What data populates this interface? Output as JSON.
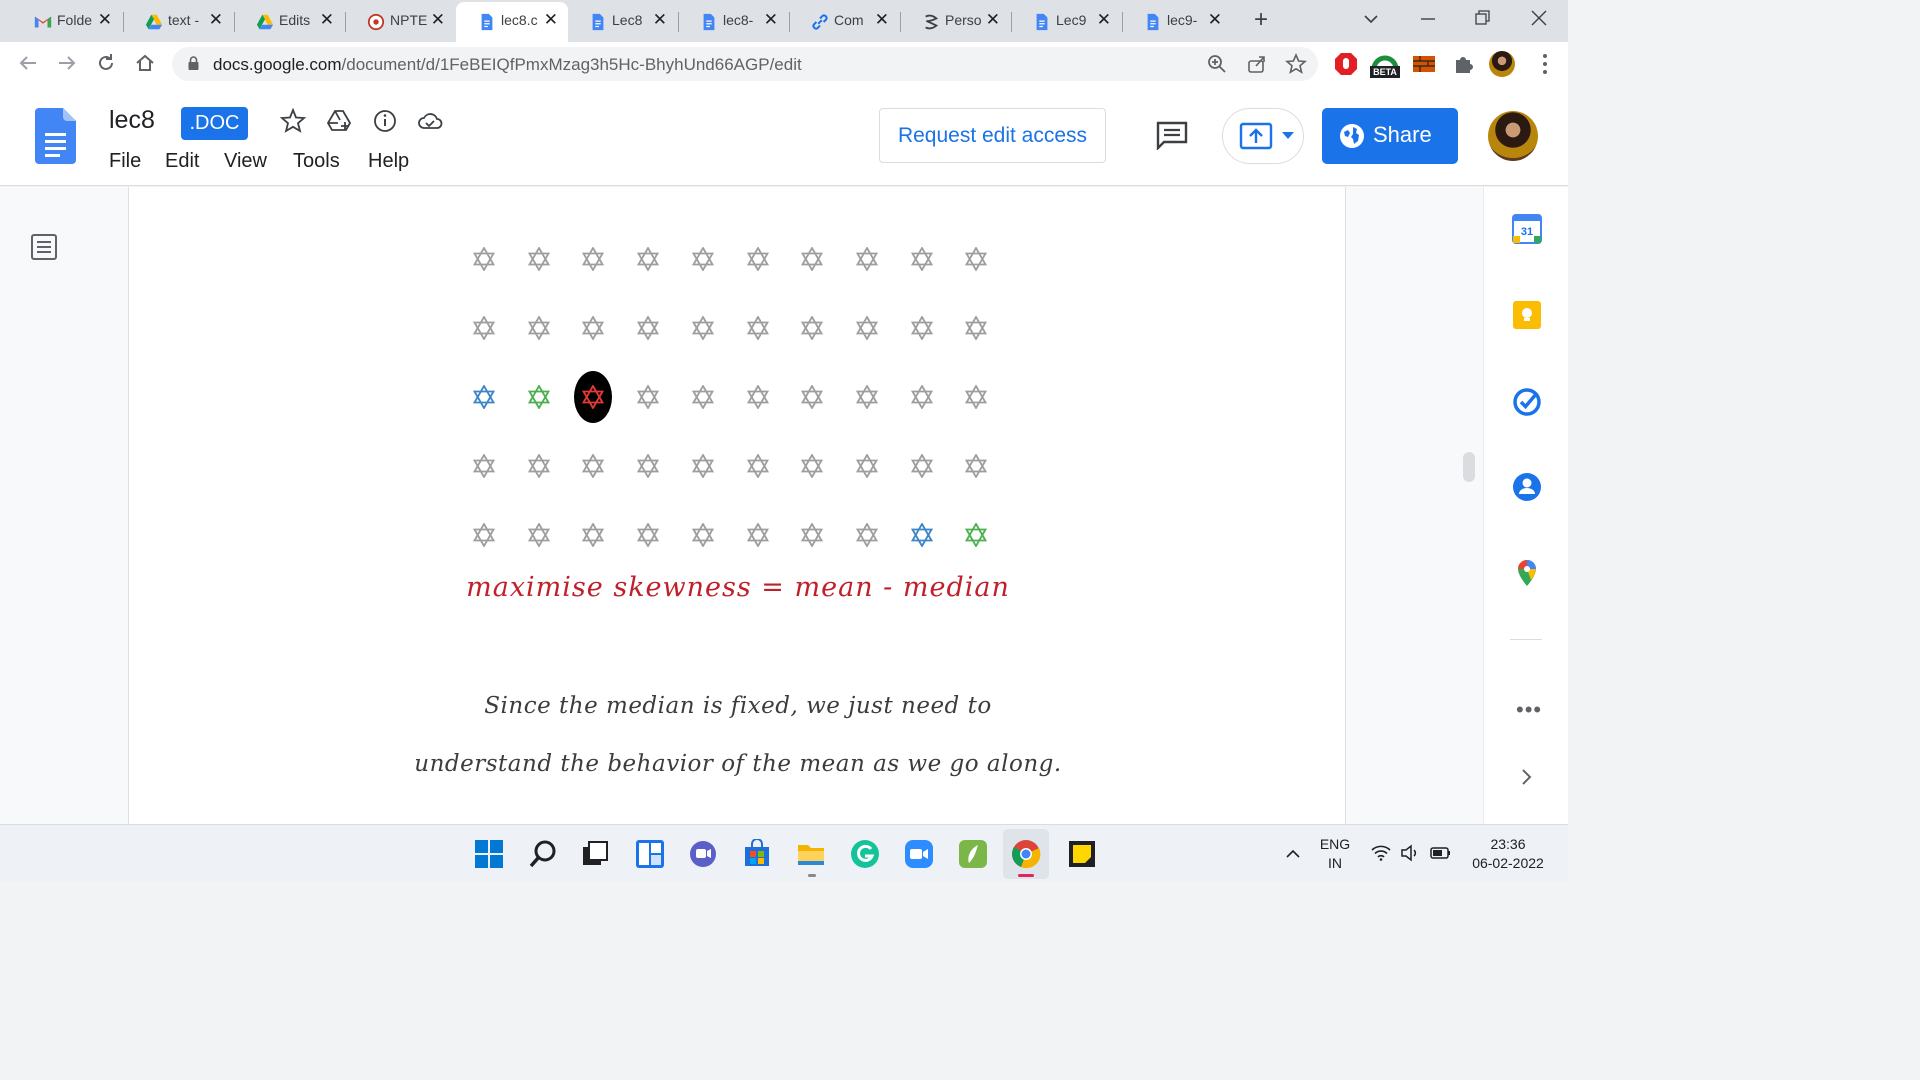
{
  "browser": {
    "tabs": [
      {
        "label": "Folde",
        "icon": "gmail-icon",
        "active": false
      },
      {
        "label": "text -",
        "icon": "google-drive-icon",
        "active": false
      },
      {
        "label": "Edits",
        "icon": "google-drive-icon",
        "active": false
      },
      {
        "label": "NPTE",
        "icon": "nptel-icon",
        "active": false
      },
      {
        "label": "lec8.c",
        "icon": "google-docs-icon",
        "active": true
      },
      {
        "label": "Lec8",
        "icon": "google-docs-icon",
        "active": false
      },
      {
        "label": "lec8-",
        "icon": "google-docs-icon",
        "active": false
      },
      {
        "label": "Com",
        "icon": "link-icon",
        "active": false
      },
      {
        "label": "Perso",
        "icon": "perso-icon",
        "active": false
      },
      {
        "label": "Lec9",
        "icon": "google-docs-icon",
        "active": false
      },
      {
        "label": "lec9-",
        "icon": "google-docs-icon",
        "active": false
      }
    ],
    "url_host": "docs.google.com",
    "url_path": "/document/d/1FeBEIQfPmxMzag3h5Hc-BhyhUnd66AGP/edit",
    "extension_badge": "BETA"
  },
  "doc": {
    "title": "lec8",
    "format_badge": ".DOC",
    "menu": [
      "File",
      "Edit",
      "View",
      "Tools",
      "Help"
    ],
    "request_edit_label": "Request edit access",
    "share_label": "Share"
  },
  "content": {
    "star_grid": {
      "rows": 5,
      "cols": 10,
      "default_color": "#9e9e9e",
      "special": [
        {
          "row": 3,
          "col": 1,
          "color": "#3d85c6"
        },
        {
          "row": 3,
          "col": 2,
          "color": "#4caf50"
        },
        {
          "row": 3,
          "col": 3,
          "color": "#e53935",
          "highlighted": true
        },
        {
          "row": 5,
          "col": 9,
          "color": "#3d85c6"
        },
        {
          "row": 5,
          "col": 10,
          "color": "#4caf50"
        }
      ]
    },
    "formula": "maximise skewness = mean - median",
    "handwriting_lines": [
      "Since the median is fixed, we just need to",
      "understand the behavior of the mean as we go along."
    ]
  },
  "taskbar": {
    "apps": [
      "start-icon",
      "search-icon",
      "task-view-icon",
      "widgets-icon",
      "teams-chat-icon",
      "microsoft-store-icon",
      "file-explorer-icon",
      "grammarly-icon",
      "zoom-icon",
      "evernote-icon",
      "chrome-icon",
      "sticky-notes-icon"
    ],
    "lang_top": "ENG",
    "lang_bottom": "IN",
    "time": "23:36",
    "date": "06-02-2022"
  },
  "colors": {
    "accent": "#1a73e8",
    "formula_red": "#c0202a"
  }
}
